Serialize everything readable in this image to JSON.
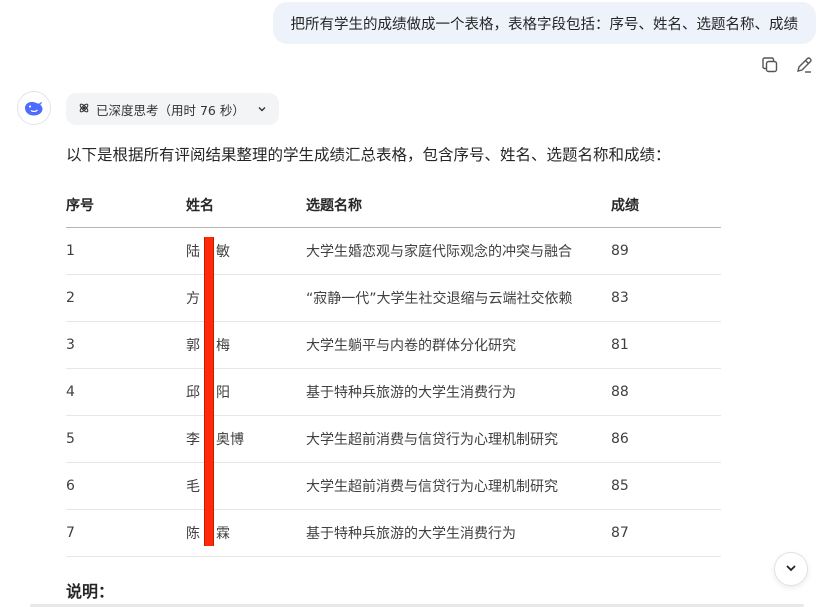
{
  "user_message": "把所有学生的成绩做成一个表格，表格字段包括：序号、姓名、选题名称、成绩",
  "message_actions": [
    {
      "icon": "copy-icon"
    },
    {
      "icon": "edit-icon"
    }
  ],
  "assistant": {
    "avatar_icon": "deepseek-whale-icon",
    "think_chip": {
      "icon": "atom-icon",
      "label": "已深度思考（用时 76 秒）",
      "expand_icon": "chevron-down-icon"
    },
    "intro": "以下是根据所有评阅结果整理的学生成绩汇总表格，包含序号、姓名、选题名称和成绩：",
    "table": {
      "headers": [
        "序号",
        "姓名",
        "选题名称",
        "成绩"
      ],
      "rows": [
        {
          "no": "1",
          "name": "陆",
          "name_tail": "敏",
          "topic": "大学生婚恋观与家庭代际观念的冲突与融合",
          "score": "89"
        },
        {
          "no": "2",
          "name": "方",
          "name_tail": "",
          "topic": "“寂静一代”大学生社交退缩与云端社交依赖",
          "score": "83"
        },
        {
          "no": "3",
          "name": "郭",
          "name_tail": "梅",
          "topic": "大学生躺平与内卷的群体分化研究",
          "score": "81"
        },
        {
          "no": "4",
          "name": "邱",
          "name_tail": "阳",
          "topic": "基于特种兵旅游的大学生消费行为",
          "score": "88"
        },
        {
          "no": "5",
          "name": "李",
          "name_tail": "奥博",
          "topic": "大学生超前消费与信贷行为心理机制研究",
          "score": "86"
        },
        {
          "no": "6",
          "name": "毛",
          "name_tail": "",
          "topic": "大学生超前消费与信贷行为心理机制研究",
          "score": "85"
        },
        {
          "no": "7",
          "name": "陈",
          "name_tail": "霖",
          "topic": "基于特种兵旅游的大学生消费行为",
          "score": "87"
        }
      ]
    },
    "note_heading": "说明："
  },
  "colors": {
    "accent": "#4d6bfe",
    "user_bubble": "#eef2fb",
    "redaction": "#ff2a0a"
  }
}
